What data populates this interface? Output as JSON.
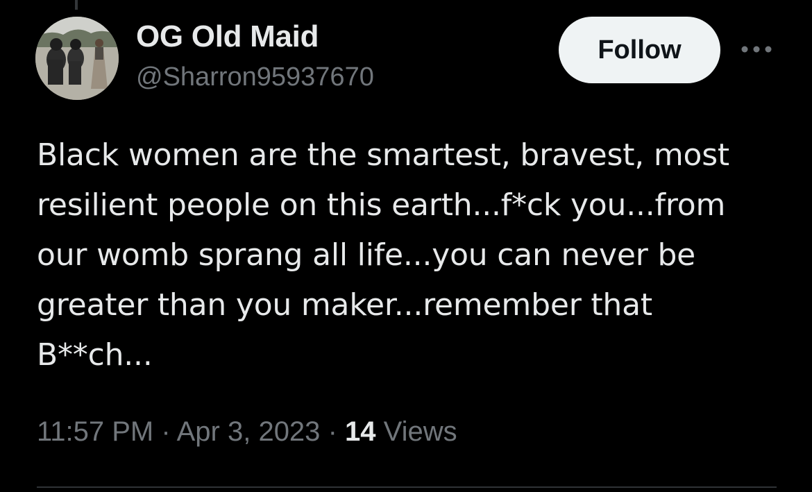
{
  "author": {
    "display_name": "OG Old Maid",
    "handle": "@Sharron95937670"
  },
  "actions": {
    "follow_label": "Follow",
    "more_icon": "more-horizontal-icon"
  },
  "tweet": {
    "text": "Black women are the smartest, bravest, most\nresilient people on this earth...f*ck you...from\nour womb sprang all life...you can never be\ngreater than you maker...remember that\nB**ch..."
  },
  "meta": {
    "time": "11:57 PM",
    "separator": "·",
    "date": "Apr 3, 2023",
    "views_count": "14",
    "views_label": "Views"
  },
  "colors": {
    "background": "#000000",
    "primary_text": "#e7e9ea",
    "secondary_text": "#71767b",
    "follow_bg": "#eff3f4",
    "divider": "#2f3336"
  }
}
